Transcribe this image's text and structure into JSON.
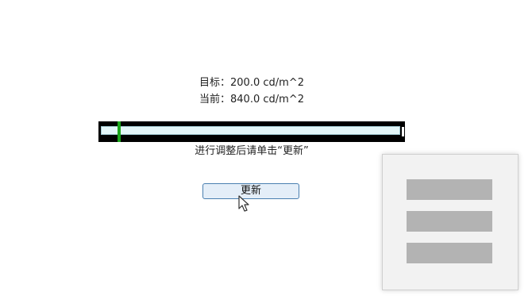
{
  "readout": {
    "target_label": "目标：",
    "target_value": "200.0 cd/m^2",
    "current_label": "当前：",
    "current_value": "840.0 cd/m^2"
  },
  "meter": {
    "marker_color": "#1aa51a",
    "track_color": "#e3f6f8"
  },
  "instruction": "进行调整后请单击“更新”",
  "update_button": {
    "label": "更新"
  },
  "menu_icon": {
    "name": "hamburger-menu-icon",
    "bar_color": "#b3b3b3"
  }
}
